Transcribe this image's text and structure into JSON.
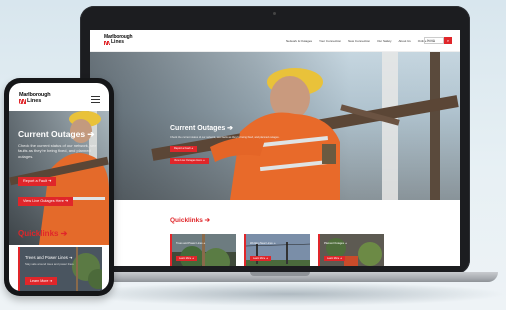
{
  "brand": {
    "logo_line1": "Marlborough",
    "logo_line2": "Lines",
    "accent": "#e0262a"
  },
  "desktop": {
    "nav": [
      "Network & Outages",
      "Your Connection",
      "New Connection",
      "Our Safety",
      "About Us",
      "Online Portal"
    ],
    "search_placeholder": "Search",
    "search_icon": "magnifier-icon",
    "hero": {
      "title": "Current Outages ➔",
      "text": "Check the current status of our network, see faults as they’re being fixed, and planned outages.",
      "buttons": [
        "Report a Fault ➔",
        "View Live Outages Here ➔"
      ]
    },
    "quicklinks": {
      "title": "Quicklinks ➔",
      "cards": [
        {
          "label": "Trees and Power Lines ➔",
          "button": "Learn More ➔"
        },
        {
          "label": "Working Near Lines ➔",
          "button": "Learn More ➔"
        },
        {
          "label": "Planned Outages ➔",
          "button": "Learn More ➔"
        }
      ]
    }
  },
  "mobile": {
    "menu_icon": "hamburger-menu-icon",
    "hero": {
      "title": "Current Outages ➔",
      "text": "Check the current status of our network, see faults as they’re being fixed, and planned outages.",
      "buttons": [
        "Report a Fault ➔",
        "View Live Outages Here ➔"
      ]
    },
    "quicklinks": {
      "title": "Quicklinks ➔",
      "card": {
        "label": "Trees and Power Lines ➔",
        "sub": "Stay safe around trees and power lines.",
        "button": "Learn More ➔"
      }
    }
  }
}
